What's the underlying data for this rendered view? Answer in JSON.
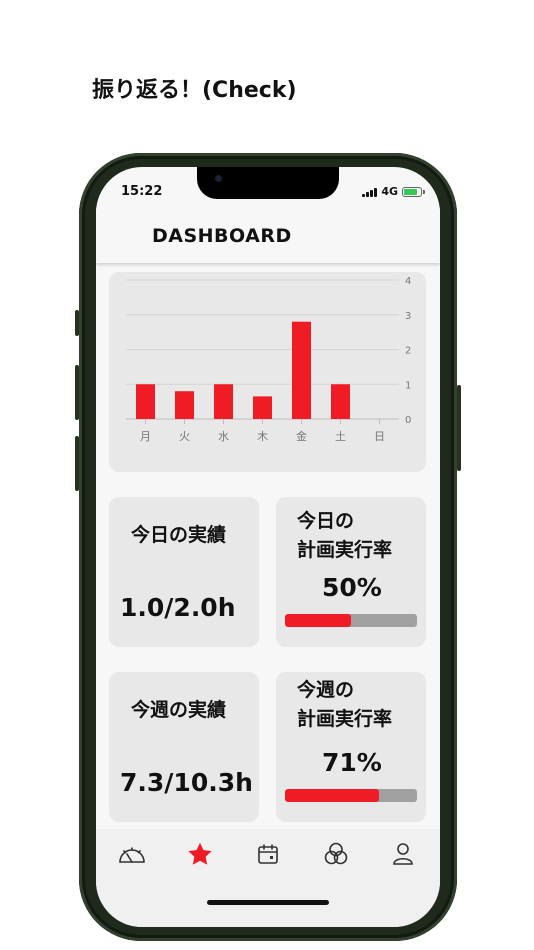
{
  "caption": "振り返る！(Check)",
  "status_bar": {
    "time": "15:22",
    "network": "4G"
  },
  "header": {
    "title": "DASHBOARD"
  },
  "chart_data": {
    "type": "bar",
    "categories": [
      "月",
      "火",
      "水",
      "木",
      "金",
      "土",
      "日"
    ],
    "values": [
      1.0,
      0.8,
      1.0,
      0.65,
      2.8,
      1.0,
      0
    ],
    "ylim": [
      0,
      4
    ],
    "yticks": [
      "0",
      "1",
      "2",
      "3",
      "4"
    ],
    "grid": true,
    "bar_color": "#ef1c25"
  },
  "cards": {
    "today_actual": {
      "label": "今日の実績",
      "value": "1.0/2.0h"
    },
    "today_plan": {
      "label_line1": "今日の",
      "label_line2": "計画実行率",
      "value": "50%",
      "progress": 0.5
    },
    "week_actual": {
      "label": "今週の実績",
      "value": "7.3/10.3h"
    },
    "week_plan": {
      "label_line1": "今週の",
      "label_line2": "計画実行率",
      "value": "71%",
      "progress": 0.71
    }
  },
  "tabs": [
    {
      "icon": "gauge-icon",
      "active": false
    },
    {
      "icon": "star-icon",
      "active": true
    },
    {
      "icon": "calendar-icon",
      "active": false
    },
    {
      "icon": "circles-icon",
      "active": false
    },
    {
      "icon": "person-icon",
      "active": false
    }
  ],
  "colors": {
    "accent": "#ef1c25",
    "card_bg": "#e9e8e8",
    "progress_track": "#a0a0a0"
  }
}
